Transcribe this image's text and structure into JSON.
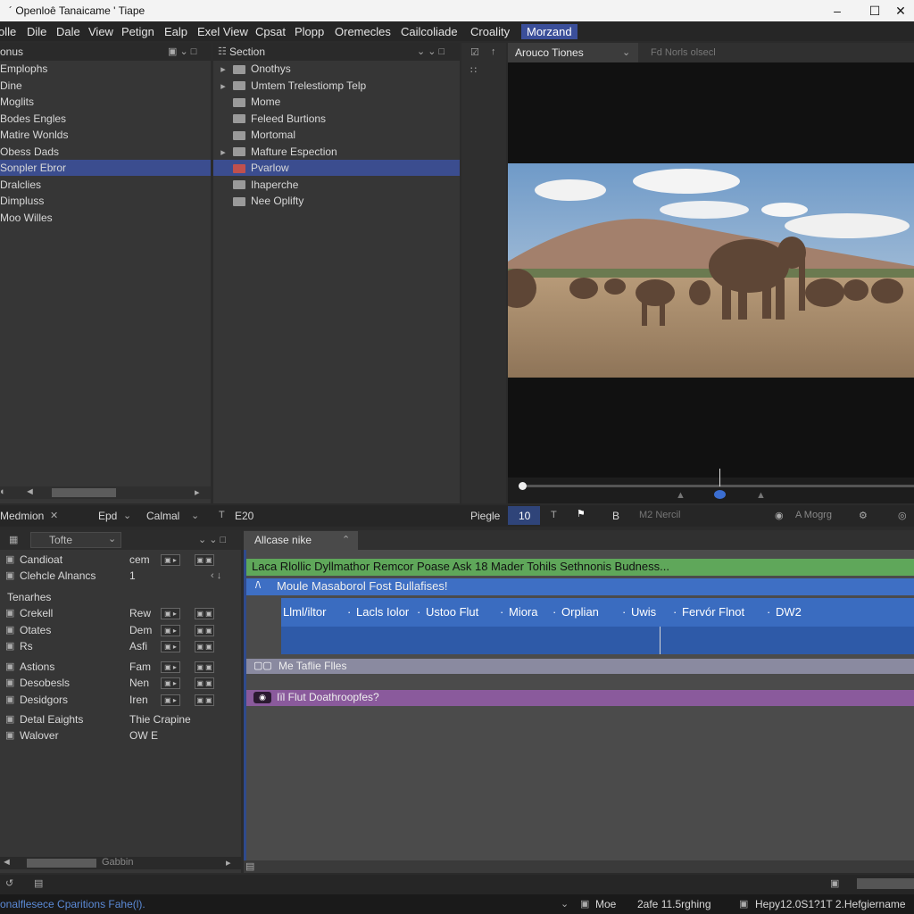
{
  "window": {
    "title": "´ Openloê Tanaicame ' Tiape"
  },
  "menu": [
    "olle",
    "Dile",
    "Dale",
    "View",
    "Petign",
    "Ealp",
    "Exel View",
    "Cpsat",
    "Plopp",
    "Oremecles",
    "Cailcoliade",
    "Croality",
    "Morzand"
  ],
  "left_panel": {
    "title": "onus",
    "items": [
      "Emplophs",
      "Dine",
      "Moglits",
      "Bodes Engles",
      "Matire Wonlds",
      "Obess Dads",
      "Sonpler Ebror",
      "Dralclies",
      "Dimpluss",
      "Moo Willes"
    ],
    "selected_index": 6
  },
  "section_panel": {
    "title": "Section",
    "items": [
      {
        "label": "Onothys",
        "arrow": true
      },
      {
        "label": "Umtem Trelestiomp Telp",
        "arrow": true
      },
      {
        "label": "Mome",
        "arrow": false
      },
      {
        "label": "Feleed Burtions",
        "arrow": false
      },
      {
        "label": "Mortomal",
        "arrow": false
      },
      {
        "label": "Mafture Espection",
        "arrow": true
      },
      {
        "label": "Pvarlow",
        "arrow": false
      },
      {
        "label": "Ihaperche",
        "arrow": false
      },
      {
        "label": "Nee Oplifty",
        "arrow": false
      }
    ],
    "selected_index": 6
  },
  "viewer": {
    "tab_left": "Arouco Tiones",
    "tab_right": "Fd Norls olsecl",
    "controls": {
      "page_label": "Piegle",
      "page_value": "10",
      "b_label": "B",
      "info": "M2 Nercil",
      "right_info": "A Mogrg"
    }
  },
  "mid_toolbar": {
    "label1": "Medmion",
    "label2": "Epd",
    "label3": "Calmal",
    "label4": "E20"
  },
  "props_panel": {
    "dropdown": "Tofte",
    "rows": [
      {
        "label": "Candioat",
        "value": "cem",
        "btns": true
      },
      {
        "label": "Clehcle Alnancs",
        "value": "1",
        "btns": false
      },
      {
        "label": "Tenarhes",
        "value": "",
        "btns": false,
        "header": true
      },
      {
        "label": "Crekell",
        "value": "Rew",
        "btns": true
      },
      {
        "label": "Otates",
        "value": "Dem",
        "btns": true
      },
      {
        "label": "Rs",
        "value": "Asfi",
        "btns": true
      },
      {
        "label": "Astions",
        "value": "Fam",
        "btns": true
      },
      {
        "label": "Desobesls",
        "value": "Nen",
        "btns": true
      },
      {
        "label": "Desidgors",
        "value": "Iren",
        "btns": true
      },
      {
        "label": "Detal Eaights",
        "value": "Thie Crapine",
        "btns": false
      },
      {
        "label": "Walover",
        "value": "OW E",
        "btns": false
      }
    ],
    "scroll_label": "Gabbin"
  },
  "timeline": {
    "tab": "Allcase nike",
    "track1": "Laca Rlollic Dyllmathor Remcor Poase Ask 18 Mader Tohils Sethnonis Budness...",
    "track2": "Moule Masaborol Fost Bullafises!",
    "clips": [
      "Llml/iltor",
      "Lacls Iolor",
      "Ustoo Flut",
      "Miora",
      "Orplian",
      "Uwis",
      "Fervór Flnot",
      "DW2"
    ],
    "track3": "Me Taflie Flles",
    "track4": "Iïl Flut Doathroopfes?"
  },
  "status": {
    "left": "onalflesece Cparitions Fahe(l).",
    "mid1": "Moe",
    "mid2": "2afe 11.5rghing",
    "right": "Hepy12.0S1?1T 2.Hefgiername"
  },
  "colors": {
    "accent": "#3b4d8f",
    "green_track": "#5fa75a",
    "blue_track": "#3e6fc4",
    "purple_track": "#8a5a9c"
  }
}
